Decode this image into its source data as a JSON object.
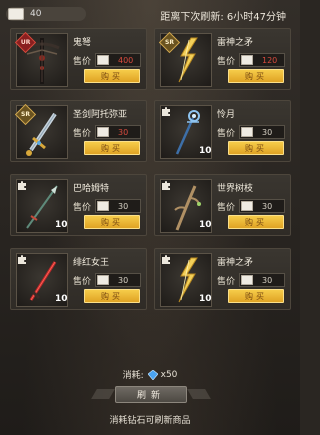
{
  "topbar": {
    "currency_amount": "40",
    "refresh_countdown": "距离下次刷新: 6小时47分钟"
  },
  "shop": {
    "price_label": "售价",
    "buy_label": "购买",
    "items": [
      {
        "name": "鬼弩",
        "price": "400",
        "price_status": "insufficient",
        "badge": "UR",
        "quantity": "",
        "icon": "crossbow-icon"
      },
      {
        "name": "雷神之矛",
        "price": "120",
        "price_status": "insufficient",
        "badge": "SR",
        "quantity": "",
        "icon": "lightning-spear-icon"
      },
      {
        "name": "圣剑阿托弥亚",
        "price": "30",
        "price_status": "insufficient",
        "badge": "SR",
        "quantity": "",
        "icon": "holy-sword-icon"
      },
      {
        "name": "怜月",
        "price": "30",
        "price_status": "normal",
        "badge": "puzzle",
        "quantity": "10",
        "icon": "moon-staff-icon"
      },
      {
        "name": "巴哈姆特",
        "price": "30",
        "price_status": "normal",
        "badge": "puzzle",
        "quantity": "10",
        "icon": "spear-icon"
      },
      {
        "name": "世界树枝",
        "price": "30",
        "price_status": "normal",
        "badge": "puzzle",
        "quantity": "10",
        "icon": "tree-branch-icon"
      },
      {
        "name": "绯红女王",
        "price": "30",
        "price_status": "normal",
        "badge": "puzzle",
        "quantity": "10",
        "icon": "crimson-blade-icon"
      },
      {
        "name": "雷神之矛",
        "price": "30",
        "price_status": "normal",
        "badge": "puzzle",
        "quantity": "10",
        "icon": "lightning-spear-icon"
      }
    ]
  },
  "footer": {
    "cost_label": "消耗:",
    "cost_amount": "x50",
    "refresh_label": "刷新",
    "hint": "消耗钻石可刷新商品"
  },
  "colors": {
    "price_insufficient": "#d94b3e",
    "buy_button": "#f0b83a",
    "panel": "#34302a"
  }
}
